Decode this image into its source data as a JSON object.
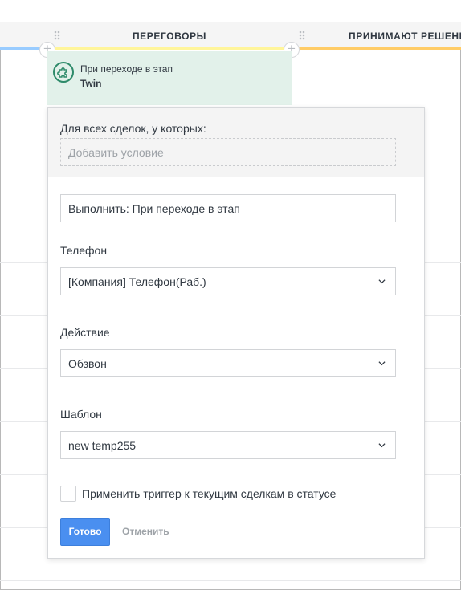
{
  "pipeline": {
    "columns": [
      {
        "title": "ПЕРЕГОВОРЫ",
        "stripe_color": "#fff59a"
      },
      {
        "title": "ПРИНИМАЮТ РЕШЕНИЕ",
        "stripe_color": "#ffcc66"
      }
    ],
    "left_stripe_color": "#99ccff"
  },
  "trigger_card": {
    "name": "При переходе в этап",
    "title": "Twin",
    "icon": "puzzle-icon"
  },
  "settings_panel": {
    "conditions_label": "Для всех сделок, у которых:",
    "add_condition_placeholder": "Добавить условие",
    "execute_value": "Выполнить: При переходе в этап",
    "phone_label": "Телефон",
    "phone_value": "[Компания] Телефон(Раб.)",
    "action_label": "Действие",
    "action_value": "Обзвон",
    "template_label": "Шаблон",
    "template_value": "new temp255",
    "apply_checkbox_label": "Применить триггер к текущим сделкам в статусе",
    "apply_checked": false,
    "done_label": "Готово",
    "cancel_label": "Отменить"
  },
  "colors": {
    "accent": "#4a8ff0",
    "trigger_card_bg": "#e2f1ea",
    "trigger_icon": "#2e8b6a"
  }
}
